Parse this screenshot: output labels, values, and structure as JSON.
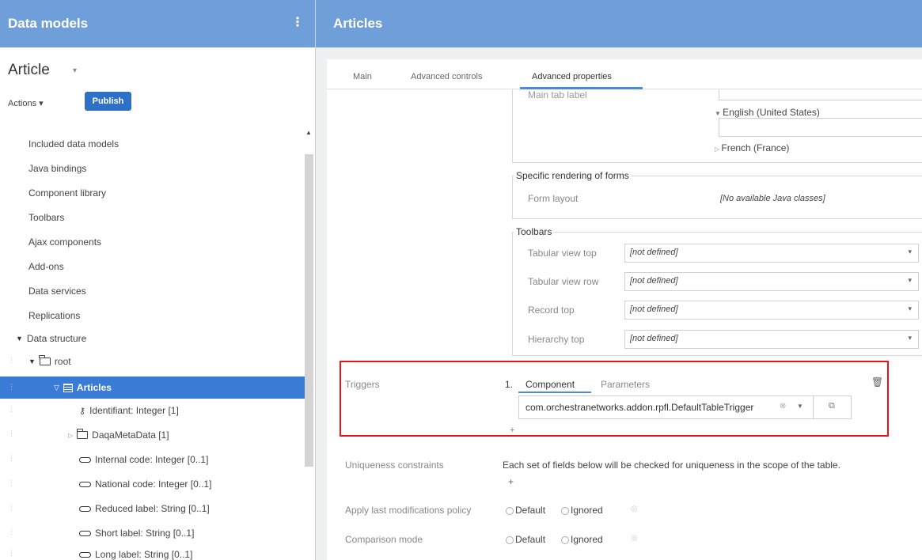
{
  "left": {
    "header_title": "Data models",
    "kebab": "⋮",
    "model_title": "Article",
    "model_caret": "▾",
    "actions_label": "Actions ▾",
    "publish_label": "Publish",
    "nav_items": [
      "Included data models",
      "Java bindings",
      "Component library",
      "Toolbars",
      "Ajax components",
      "Add-ons",
      "Data services",
      "Replications"
    ],
    "data_structure_label": "Data structure",
    "root_label": "root",
    "articles_label": "Articles",
    "fields": {
      "identifiant": "Identifiant: Integer  [1]",
      "daqa": "DaqaMetaData [1]",
      "internal_code": "Internal code: Integer  [0..1]",
      "national_code": "National code: Integer  [0..1]",
      "reduced_label": "Reduced label: String  [0..1]",
      "short_label": "Short label: String  [0..1]",
      "long_label": "Long label: String  [0..1]"
    }
  },
  "right": {
    "header_title": "Articles",
    "tabs": [
      "Main",
      "Advanced controls",
      "Advanced properties"
    ],
    "main_tab_label": "Main tab label",
    "lang_en": "English (United States)",
    "lang_fr": "French (France)",
    "specific_rendering_legend": "Specific rendering of forms",
    "form_layout_label": "Form layout",
    "form_layout_value": "[No available Java classes]",
    "toolbars_legend": "Toolbars",
    "toolbar_rows": [
      {
        "label": "Tabular view top",
        "value": "[not defined]"
      },
      {
        "label": "Tabular view row",
        "value": "[not defined]"
      },
      {
        "label": "Record top",
        "value": "[not defined]"
      },
      {
        "label": "Hierarchy top",
        "value": "[not defined]"
      }
    ],
    "triggers_label": "Triggers",
    "trigger_index": "1.",
    "trigger_tab_component": "Component",
    "trigger_tab_parameters": "Parameters",
    "trigger_value": "com.orchestranetworks.addon.rpfl.DefaultTableTrigger",
    "uniqueness_label": "Uniqueness constraints",
    "uniqueness_text": "Each set of fields below will be checked for uniqueness in the scope of the table.",
    "apply_label": "Apply last modifications policy",
    "comparison_label": "Comparison mode",
    "radio_default": "Default",
    "radio_ignored": "Ignored",
    "plus": "+"
  }
}
